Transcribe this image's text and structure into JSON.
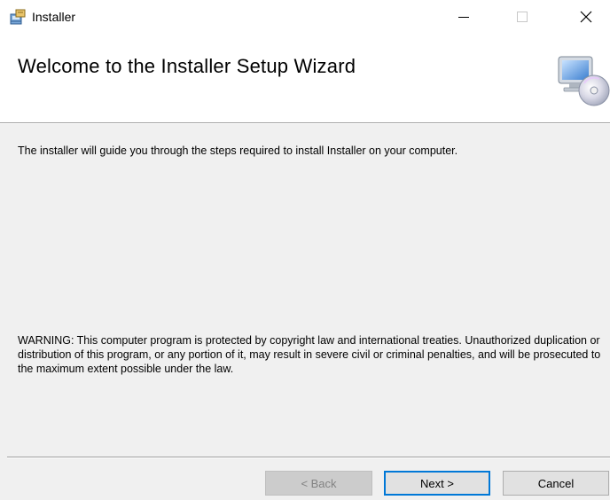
{
  "window": {
    "title": "Installer",
    "controls": {
      "minimize_icon": "minimize-icon",
      "maximize_icon": "maximize-icon",
      "close_icon": "close-icon"
    }
  },
  "header": {
    "title": "Welcome to the Installer Setup Wizard",
    "graphic_icon": "computer-disc-icon"
  },
  "body": {
    "intro": "The installer will guide you through the steps required to install Installer on your computer.",
    "warning": "WARNING: This computer program is protected by copyright law and international treaties. Unauthorized duplication or distribution of this program, or any portion of it, may result in severe civil or criminal penalties, and will be prosecuted to the maximum extent possible under the law."
  },
  "footer": {
    "back_label": "< Back",
    "next_label": "Next >",
    "cancel_label": "Cancel"
  },
  "colors": {
    "accent": "#0078d7",
    "panel": "#f0f0f0",
    "header_bg": "#ffffff"
  }
}
